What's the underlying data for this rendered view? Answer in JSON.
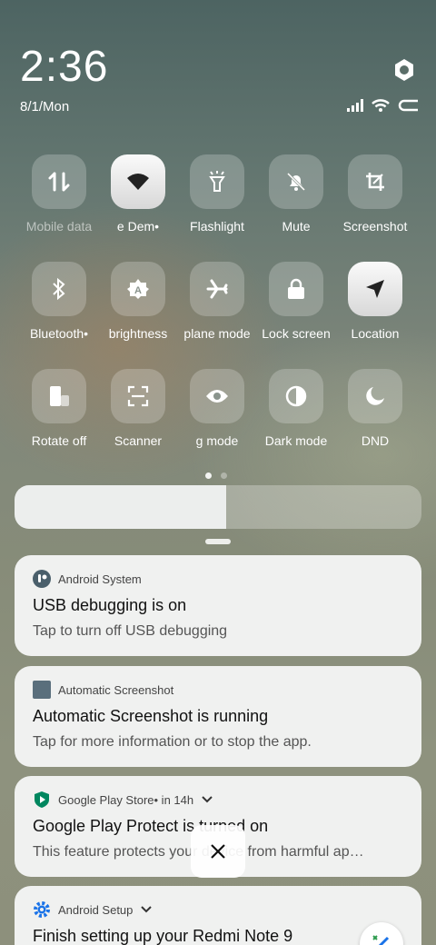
{
  "status": {
    "time": "2:36",
    "date": "8/1/Mon",
    "icons": [
      "settings-gear-icon",
      "signal-icon",
      "wifi-icon",
      "battery-icon"
    ]
  },
  "tiles": [
    {
      "label": "Mobile data",
      "icon": "updown-arrows",
      "active": false
    },
    {
      "label": "e   Dem•",
      "icon": "wifi",
      "active": true
    },
    {
      "label": "Flashlight",
      "icon": "flashlight",
      "active": false
    },
    {
      "label": "Mute",
      "icon": "bell-off",
      "active": false
    },
    {
      "label": "Screenshot",
      "icon": "crop",
      "active": false
    },
    {
      "label": "Bluetooth•",
      "icon": "bluetooth",
      "active": false
    },
    {
      "label": "brightness",
      "icon": "auto-brightness",
      "active": false
    },
    {
      "label": "plane mode",
      "icon": "airplane",
      "active": false
    },
    {
      "label": "Lock screen",
      "icon": "lock",
      "active": false
    },
    {
      "label": "Location",
      "icon": "location-arrow",
      "active": true
    },
    {
      "label": "Rotate off",
      "icon": "rotate",
      "active": false
    },
    {
      "label": "Scanner",
      "icon": "scanner",
      "active": false
    },
    {
      "label": "g mode",
      "icon": "eye",
      "active": false
    },
    {
      "label": "Dark mode",
      "icon": "half-circle",
      "active": false
    },
    {
      "label": "DND",
      "icon": "moon",
      "active": false
    }
  ],
  "brightness": {
    "level": 0.52
  },
  "notifications": [
    {
      "app": "Android System",
      "meta": "",
      "title": "USB debugging is on",
      "text": "Tap to turn off USB debugging",
      "icon": "android-system-icon"
    },
    {
      "app": "Automatic Screenshot",
      "meta": "",
      "title": "Automatic Screenshot is running",
      "text": "Tap for more information or to stop the app.",
      "icon": "app-square-icon"
    },
    {
      "app": "Google Play Store",
      "meta": " • in 14h",
      "title": "Google Play Protect is turned on",
      "text": "This feature protects your device from harmful ap…",
      "icon": "play-protect-icon"
    },
    {
      "app": "Android Setup",
      "meta": "",
      "title": "Finish setting up your Redmi Note 9",
      "text": "",
      "icon": "gear-blue-icon"
    }
  ],
  "colors": {
    "accent_blue": "#1a73e8",
    "play_green": "#01875f",
    "app_grey": "#5a6f7c"
  }
}
